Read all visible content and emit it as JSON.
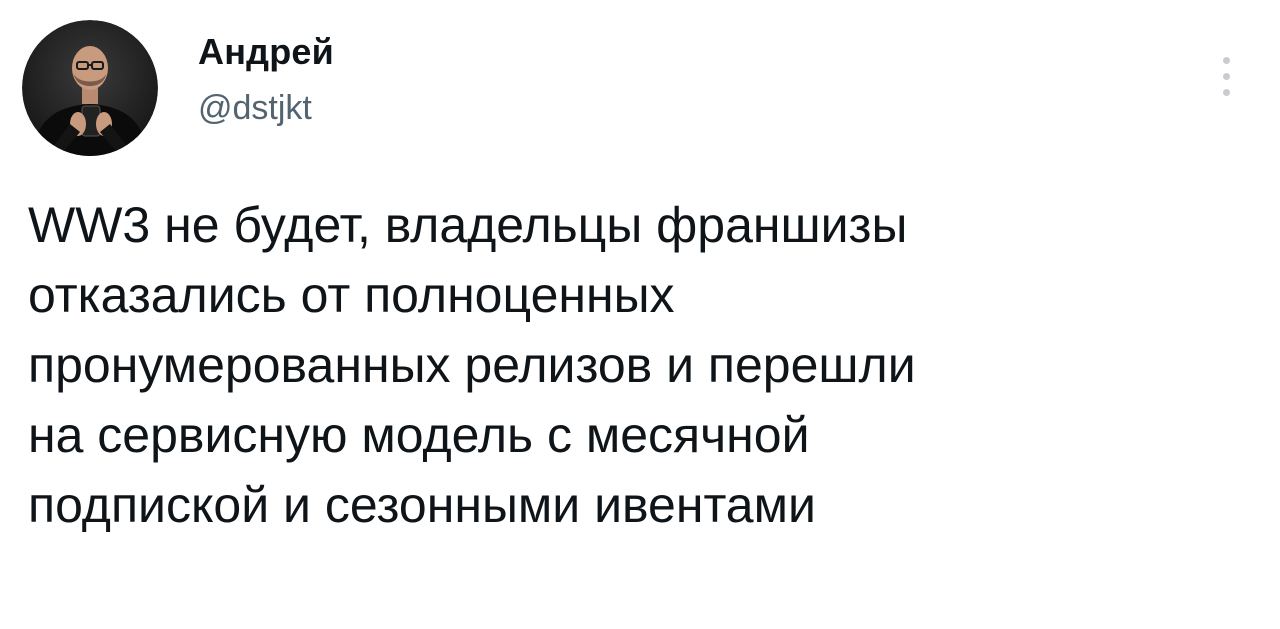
{
  "author": {
    "display_name": "Андрей",
    "handle": "@dstjkt",
    "avatar_icon": "avatar-photo"
  },
  "menu": {
    "icon": "more-vertical-icon"
  },
  "tweet": {
    "lines": [
      "WW3 не будет, владельцы франшизы",
      "отказались от полноценных",
      "пронумерованных релизов и перешли",
      "на сервисную модель с месячной",
      "подпиской и сезонными ивентами"
    ]
  },
  "colors": {
    "text": "#0f1419",
    "secondary": "#536471",
    "background": "#ffffff",
    "menu_dots": "#c7ccd1"
  }
}
